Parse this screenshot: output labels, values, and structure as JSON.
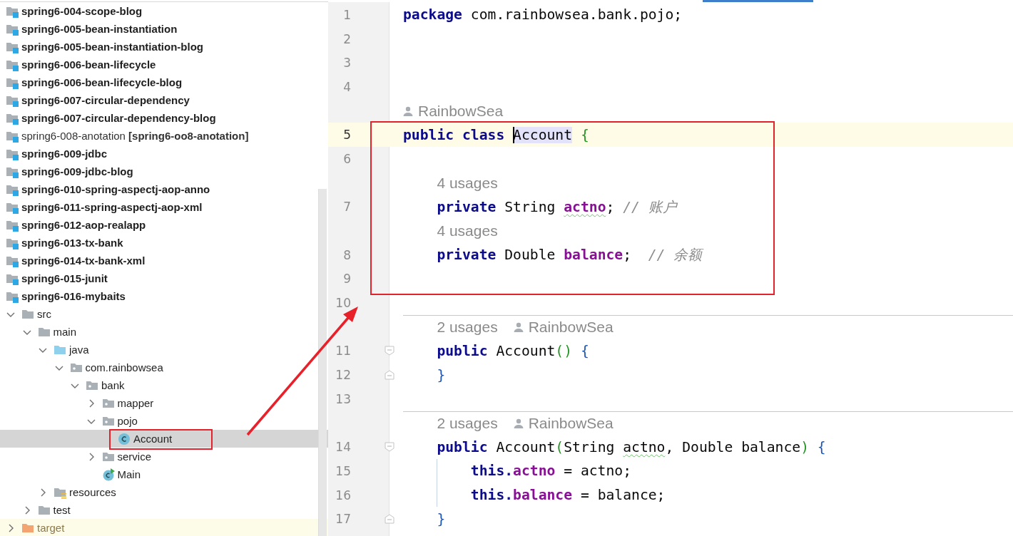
{
  "project_tree": [
    {
      "label": "spring6-004-scope-blog",
      "kind": "module",
      "selected": false
    },
    {
      "label": "spring6-005-bean-instantiation",
      "kind": "module",
      "selected": false
    },
    {
      "label": "spring6-005-bean-instantiation-blog",
      "kind": "module",
      "selected": false
    },
    {
      "label": "spring6-006-bean-lifecycle",
      "kind": "module",
      "selected": false
    },
    {
      "label": "spring6-006-bean-lifecycle-blog",
      "kind": "module",
      "selected": false
    },
    {
      "label": "spring6-007-circular-dependency",
      "kind": "module",
      "selected": false
    },
    {
      "label": "spring6-007-circular-dependency-blog",
      "kind": "module",
      "selected": false
    },
    {
      "label": "spring6-008-anotation **[spring6-oo8-anotation]**",
      "kind": "renamed",
      "selected": false
    },
    {
      "label": "spring6-009-jdbc",
      "kind": "module",
      "selected": false
    },
    {
      "label": "spring6-009-jdbc-blog",
      "kind": "module",
      "selected": false
    },
    {
      "label": "spring6-010-spring-aspectj-aop-anno",
      "kind": "module",
      "selected": false
    },
    {
      "label": "spring6-011-spring-aspectj-aop-xml",
      "kind": "module",
      "selected": false
    },
    {
      "label": "spring6-012-aop-realapp",
      "kind": "module",
      "selected": false
    },
    {
      "label": "spring6-013-tx-bank",
      "kind": "module",
      "selected": false
    },
    {
      "label": "spring6-014-tx-bank-xml",
      "kind": "module",
      "selected": false
    },
    {
      "label": "spring6-015-junit",
      "kind": "module",
      "selected": false
    },
    {
      "label": "spring6-016-mybaits",
      "kind": "module",
      "selected": false
    },
    {
      "label": "src",
      "kind": "folder",
      "expanded": true,
      "selected": false,
      "children": [
        {
          "label": "main",
          "kind": "folder",
          "expanded": true,
          "selected": false,
          "children": [
            {
              "label": "java",
              "kind": "source",
              "expanded": true,
              "selected": false,
              "children": [
                {
                  "label": "com.rainbowsea",
                  "kind": "package",
                  "expanded": true,
                  "selected": false,
                  "children": [
                    {
                      "label": "bank",
                      "kind": "package",
                      "expanded": true,
                      "selected": false,
                      "children": [
                        {
                          "label": "mapper",
                          "kind": "package",
                          "expanded": false,
                          "selected": false
                        },
                        {
                          "label": "pojo",
                          "kind": "package",
                          "expanded": true,
                          "selected": false,
                          "children": [
                            {
                              "label": "Account",
                              "kind": "class",
                              "selected": true
                            }
                          ]
                        },
                        {
                          "label": "service",
                          "kind": "package",
                          "expanded": false,
                          "selected": false
                        },
                        {
                          "label": "Main",
                          "kind": "main",
                          "selected": false
                        }
                      ]
                    }
                  ]
                }
              ]
            },
            {
              "label": "resources",
              "kind": "resources",
              "expanded": false,
              "selected": false
            }
          ]
        },
        {
          "label": "test",
          "kind": "folder",
          "expanded": false,
          "selected": false
        }
      ]
    },
    {
      "label": "target",
      "kind": "excluded",
      "expanded": false,
      "selected": false
    }
  ],
  "editor": {
    "lines": [
      {
        "number": "1",
        "tokens": [
          {
            "kind": "keyword",
            "text": "package"
          },
          {
            "kind": "plain",
            "text": " com.rainbowsea.bank.pojo;"
          }
        ]
      },
      {
        "number": "2"
      },
      {
        "number": "3"
      },
      {
        "number": "4"
      },
      {
        "number": "5",
        "current": true,
        "hint": {
          "author": "RainbowSea"
        },
        "tokens": [
          {
            "kind": "keyword",
            "text": "public"
          },
          {
            "kind": "keyword",
            "text": " class "
          },
          {
            "kind": "match",
            "text": "Account"
          },
          {
            "kind": "paren",
            "text": " {"
          }
        ]
      },
      {
        "number": "6"
      },
      {
        "number": "7",
        "hint": {
          "usages": "4 usages"
        },
        "tokens": [
          {
            "kind": "keyword",
            "text": "    private"
          },
          {
            "kind": "plain",
            "text": " String "
          },
          {
            "kind": "typofield",
            "text": "actno"
          },
          {
            "kind": "plain",
            "text": ";"
          },
          {
            "kind": "comment",
            "text": " // 账户"
          }
        ]
      },
      {
        "number": "8",
        "hint": {
          "usages": "4 usages"
        },
        "tokens": [
          {
            "kind": "keyword",
            "text": "    private"
          },
          {
            "kind": "plain",
            "text": " Double "
          },
          {
            "kind": "field",
            "text": "balance"
          },
          {
            "kind": "plain",
            "text": ";"
          },
          {
            "kind": "comment",
            "text": "  // 余额"
          }
        ]
      },
      {
        "number": "9"
      },
      {
        "number": "10"
      },
      {
        "number": "11",
        "separator": true,
        "fold_start": true,
        "hint": {
          "usages": "2 usages",
          "author": "RainbowSea"
        },
        "tokens": [
          {
            "kind": "keyword",
            "text": "    public"
          },
          {
            "kind": "plain",
            "text": " Account"
          },
          {
            "kind": "paren",
            "text": "()"
          },
          {
            "kind": "brace",
            "text": " {"
          }
        ]
      },
      {
        "number": "12",
        "fold_end": true,
        "tokens": [
          {
            "kind": "brace",
            "text": "    }"
          }
        ]
      },
      {
        "number": "13"
      },
      {
        "number": "14",
        "separator": true,
        "fold_start": true,
        "hint": {
          "usages": "2 usages",
          "author": "RainbowSea"
        },
        "tokens": [
          {
            "kind": "keyword",
            "text": "    public"
          },
          {
            "kind": "plain",
            "text": " Account"
          },
          {
            "kind": "paren",
            "text": "("
          },
          {
            "kind": "plain",
            "text": "String "
          },
          {
            "kind": "typo",
            "text": "actno"
          },
          {
            "kind": "plain",
            "text": ", Double balance"
          },
          {
            "kind": "paren",
            "text": ")"
          },
          {
            "kind": "brace",
            "text": " {"
          }
        ]
      },
      {
        "number": "15",
        "guide": true,
        "tokens": [
          {
            "kind": "keyword",
            "text": "        this."
          },
          {
            "kind": "field",
            "text": "actno"
          },
          {
            "kind": "plain",
            "text": " = actno;"
          }
        ]
      },
      {
        "number": "16",
        "guide": true,
        "tokens": [
          {
            "kind": "keyword",
            "text": "        this."
          },
          {
            "kind": "field",
            "text": "balance"
          },
          {
            "kind": "plain",
            "text": " = balance;"
          }
        ]
      },
      {
        "number": "17",
        "fold_end": true,
        "tokens": [
          {
            "kind": "brace",
            "text": "    }"
          }
        ]
      }
    ]
  }
}
